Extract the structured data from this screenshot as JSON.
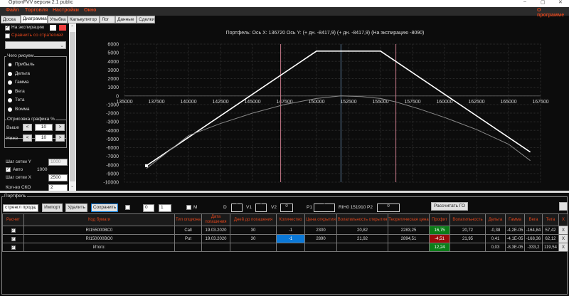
{
  "window": {
    "title": "OptionFVV версия 2.1 public"
  },
  "menu": [
    "Файл",
    "Торговля",
    "Настройки",
    "Окно"
  ],
  "menu_right": "О программе",
  "tabs": [
    "Доска",
    "Диаграмма",
    "Улыбка",
    "Калькулятор",
    "Лог",
    "Данные",
    "Сделки"
  ],
  "active_tab": "Диаграмма",
  "left": {
    "expiration_label": "На экспирацию",
    "expiration_checked": true,
    "colors": [
      "#ffffff",
      "#f04040"
    ],
    "compare_label": "Сравнить со стратегией",
    "compare_checked": false,
    "what_group": "Чего рисуем",
    "radios": [
      "Прибыль",
      "Дельта",
      "Гамма",
      "Вега",
      "Тета",
      "Вомма"
    ],
    "selected_radio": "Прибыль",
    "draw_group": "Отрисовка графика %",
    "above_label": "Выше",
    "above_value": "10",
    "below_label": "Ниже",
    "below_value": "10",
    "dec": "<",
    "inc": ">",
    "grid_y_label": "Шаг сетки Y",
    "grid_y_value": "1000",
    "auto_label": "Авто",
    "auto_checked": true,
    "auto_value": "1000",
    "grid_x_label": "Шаг сетки X",
    "grid_x_value": "2500",
    "sko_label": "Кол-во СКО",
    "sko_value": "2"
  },
  "chart_data": {
    "type": "line",
    "title": "Портфель:  Ось X:  136720 Ось Y:   (+ дн. -8417,9)  (+ дн. -8417,9)  (На экспирацию -8090)",
    "xlim": [
      135000,
      167500
    ],
    "ylim": [
      -10000,
      6000
    ],
    "xticks": [
      135000,
      137500,
      140000,
      142500,
      145000,
      147500,
      150000,
      152500,
      155000,
      157500,
      160000,
      162500,
      165000,
      167500
    ],
    "yticks": [
      6000,
      5000,
      4000,
      3000,
      2000,
      1000,
      0,
      -1000,
      -2000,
      -3000,
      -4000,
      -5000,
      -6000,
      -7000,
      -8000,
      -9000,
      -10000
    ],
    "grid": true,
    "series": [
      {
        "color": "#ffffff",
        "x": [
          136720,
          150000,
          155000,
          166700
        ],
        "y": [
          -8090,
          5190,
          5190,
          -6510
        ]
      },
      {
        "color": "#8a8a8a",
        "x": [
          136720,
          140000,
          142500,
          145000,
          147500,
          150000,
          151900,
          153500,
          155000,
          156200,
          158000,
          160000,
          162500,
          165000,
          166700
        ],
        "y": [
          -8418,
          -4600,
          -3200,
          -2000,
          -1000,
          -300,
          0,
          -80,
          -300,
          -700,
          -1500,
          -2500,
          -3900,
          -5600,
          -7500
        ]
      }
    ],
    "vlines": [
      {
        "x": 147200,
        "color": "#c87a8a"
      },
      {
        "x": 151910,
        "color": "#5a7a9a"
      },
      {
        "x": 156200,
        "color": "#c87a8a"
      }
    ],
    "marker": {
      "x": 136720,
      "y": -8090
    }
  },
  "portfolio": {
    "group": "Портфель",
    "strategy": "стренгл прода",
    "import": "Импорт",
    "delete": "Удалить",
    "save": "Сохранить",
    "sh": "SH",
    "spin1": "0",
    "spin2": "1",
    "m": "M",
    "d": "D",
    "d_val": "0",
    "v1": "V1",
    "v1_val": "0",
    "v2": "V2",
    "v2_val": "0",
    "p1": "P1",
    "p1_val": "0",
    "ticker": "RIH0 151910",
    "p2": "P2",
    "p2_val": "0",
    "calc_go": "Рассчитать ГО",
    "headers": [
      "Расчет",
      "Код бумаги",
      "Тип опциона",
      "Дата погашения",
      "Дней до погашения",
      "Количество",
      "Цена открытия",
      "Волатильность открытия",
      "Теоретическая цена",
      "Профит",
      "Волатильность",
      "Дельта",
      "Гамма",
      "Вега",
      "Тета",
      "X"
    ],
    "rows": [
      [
        "✓",
        "RI155000BC0",
        "Call",
        "19.03.2020",
        "30",
        "-1",
        "2300",
        "20,82",
        "2283,25",
        "16,75",
        "20,72",
        "-0,38",
        "-4,2E-05",
        "-164,84",
        "57,42",
        "X"
      ],
      [
        "✓",
        "RI150000BO0",
        "Put",
        "19.03.2020",
        "30",
        "-1",
        "2890",
        "21,92",
        "2894,51",
        "-4,51",
        "21,95",
        "0,41",
        "-4,1E-05",
        "-168,36",
        "62,12",
        "X"
      ],
      [
        "✓",
        "Итого:",
        "",
        "",
        "",
        "",
        "",
        "",
        "",
        "12,24",
        "",
        "0,03",
        "-8,3E-05",
        "-333,2",
        "119,54",
        "X"
      ]
    ]
  }
}
